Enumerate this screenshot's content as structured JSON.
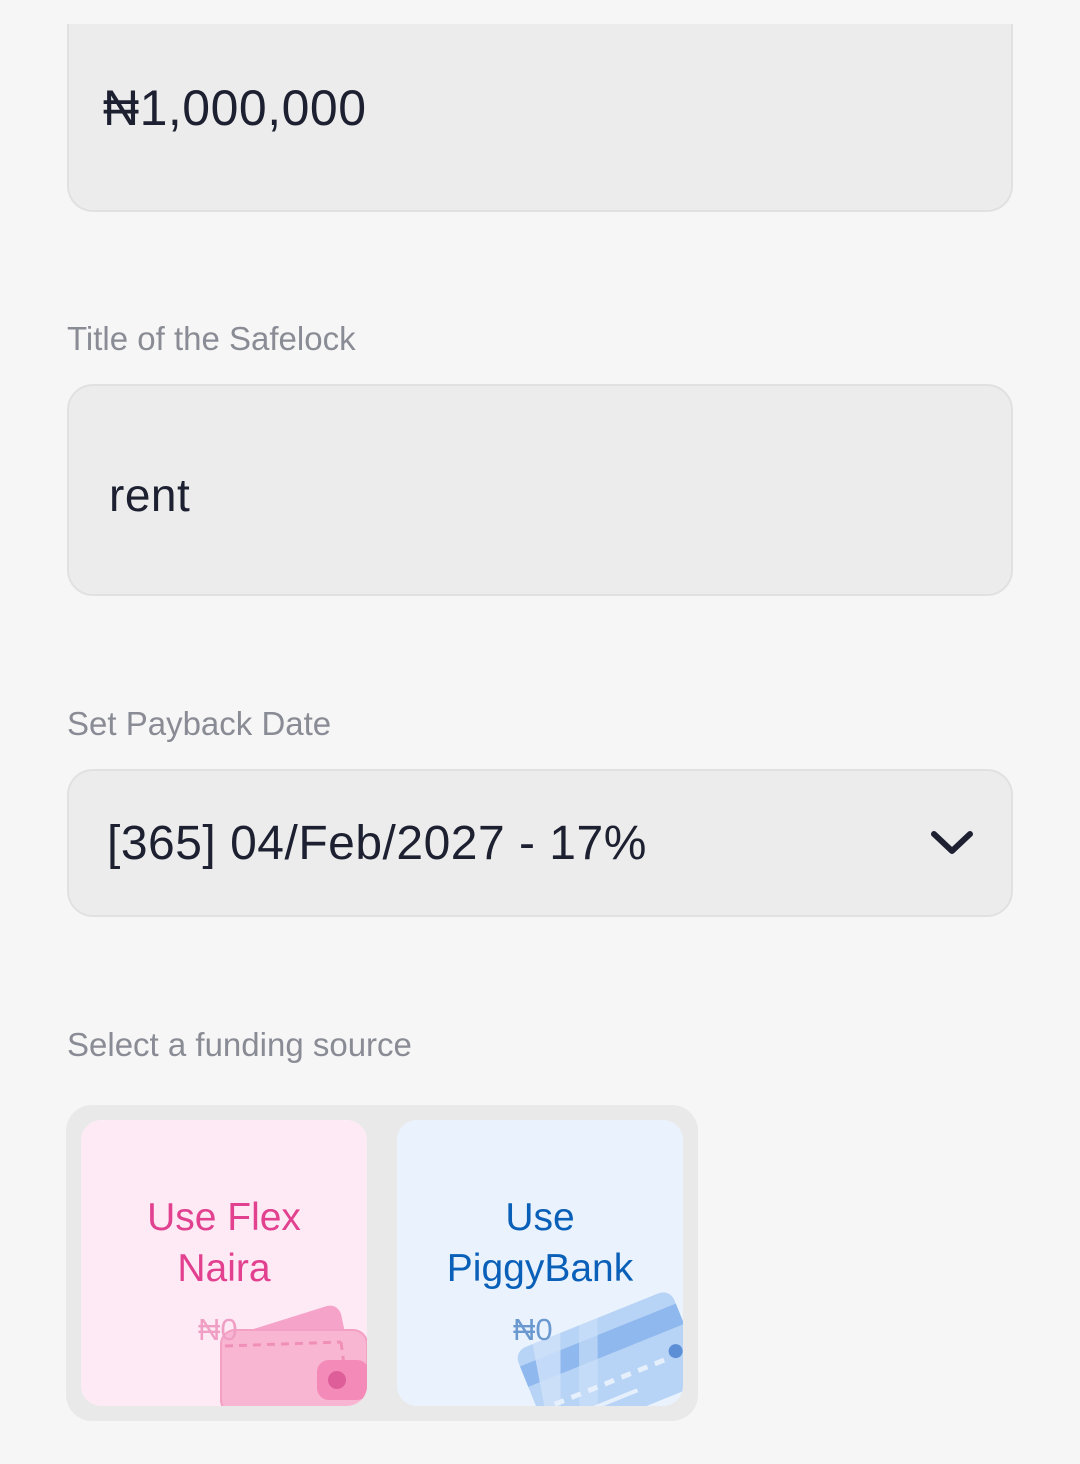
{
  "amount_field": {
    "value": "₦1,000,000"
  },
  "title_field": {
    "label": "Title of the Safelock",
    "value": "rent"
  },
  "payback_field": {
    "label": "Set Payback Date",
    "value": "[365] 04/Feb/2027 - 17%"
  },
  "funding": {
    "label": "Select a funding source",
    "options": [
      {
        "title_line1": "Use Flex",
        "title_line2": "Naira",
        "amount": "₦0",
        "color": "#e2418f",
        "icon": "wallet-icon"
      },
      {
        "title_line1": "Use",
        "title_line2": "PiggyBank",
        "amount": "₦0",
        "color": "#0a60b8",
        "icon": "credit-card-icon"
      }
    ]
  },
  "colors": {
    "background": "#f6f6f6",
    "field_bg": "#ececec",
    "label": "#8a8c95",
    "text": "#1d2030",
    "accent_blue": "#1f4fe0"
  }
}
